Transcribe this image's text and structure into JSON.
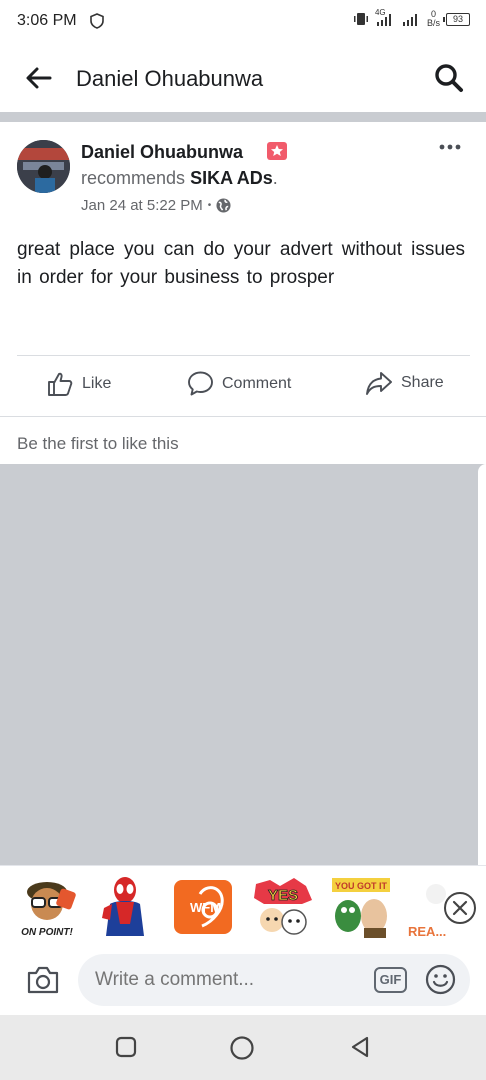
{
  "status_bar": {
    "time": "3:06 PM",
    "network": "4G",
    "net_speed_value": "0",
    "net_speed_unit": "B/s",
    "battery": "93"
  },
  "header": {
    "title": "Daniel Ohuabunwa",
    "back_icon": "arrow-left-icon",
    "search_icon": "search-icon"
  },
  "post": {
    "author": "Daniel Ohuabunwa",
    "recommends_prefix": "recommends",
    "page_name": "SIKA ADs",
    "suffix": ".",
    "timestamp": "Jan 24 at 5:22 PM",
    "separator": "•",
    "privacy_icon": "globe-icon",
    "body": "great place you can do your advert without issues  in order for your business to prosper",
    "actions": {
      "like": "Like",
      "comment": "Comment",
      "share": "Share"
    },
    "like_prompt": "Be the first to like this"
  },
  "stickers": [
    {
      "name": "on-point-sticker",
      "text": "ON POINT!"
    },
    {
      "name": "spiderman-sticker",
      "text": ""
    },
    {
      "name": "wfm-sticker",
      "text": "WFM"
    },
    {
      "name": "yes-sticker",
      "text": "YES"
    },
    {
      "name": "you-got-it-sticker",
      "text": "YOU GOT IT"
    },
    {
      "name": "reaction-sticker",
      "text": "REA..."
    }
  ],
  "comment_bar": {
    "placeholder": "Write a comment...",
    "gif_label": "GIF"
  },
  "colors": {
    "divider": "#c9ccd1",
    "text_primary": "#1c1e21",
    "text_secondary": "#65676b",
    "badge": "#f15b6b"
  }
}
